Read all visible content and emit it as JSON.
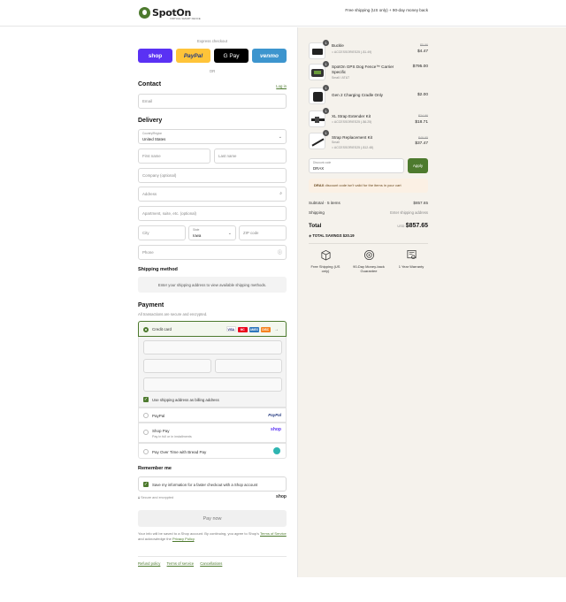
{
  "header": {
    "logo_text": "SpotOn",
    "logo_sub": "VIRTUAL SMART FENCE",
    "promo": "Free shipping (US only) + 90-day money back"
  },
  "express": {
    "label": "Express checkout",
    "buttons": [
      "shop",
      "PayPal",
      "G Pay",
      "venmo"
    ],
    "or": "OR"
  },
  "contact": {
    "title": "Contact",
    "login": "Log in",
    "email_placeholder": "Email"
  },
  "delivery": {
    "title": "Delivery",
    "country_label": "Country/Region",
    "country_value": "United States",
    "first_name": "First name",
    "last_name": "Last name",
    "company": "Company (optional)",
    "address": "Address",
    "apartment": "Apartment, suite, etc. (optional)",
    "city": "City",
    "state_label": "State",
    "state_value": "Iowa",
    "zip": "ZIP code",
    "phone": "Phone"
  },
  "shipping_method": {
    "title": "Shipping method",
    "info": "Enter your shipping address to view available shipping methods."
  },
  "payment": {
    "title": "Payment",
    "subtitle": "All transactions are secure and encrypted.",
    "credit_card": "Credit card",
    "brands": [
      "VISA",
      "MC",
      "AMEX",
      "DISC"
    ],
    "billing_same": "Use shipping address as billing address",
    "paypal": "PayPal",
    "paypal_logo": "PayPal",
    "shop_pay": "Shop Pay",
    "shop_pay_sub": "Pay in full or in installments",
    "shop_pay_logo": "shop",
    "bread": "Pay Over Time with Bread Pay"
  },
  "remember": {
    "title": "Remember me",
    "save_label": "Save my information for a faster checkout with a Shop account",
    "secure": "Secure and encrypted",
    "shop_logo": "shop"
  },
  "pay_now": "Pay now",
  "legal": {
    "text1": "Your info will be saved to a Shop account. By continuing, you agree to Shop's",
    "terms": "Terms of Service",
    "text2": "and acknowledge the",
    "privacy": "Privacy Policy",
    "end": "."
  },
  "footer_links": [
    "Refund policy",
    "Terms of service",
    "Cancellations"
  ],
  "cart": {
    "items": [
      {
        "qty": "1",
        "name": "Buckle",
        "sub": "ACCESSORIES25 (-$1.49)",
        "old_price": "$5.96",
        "price": "$4.47"
      },
      {
        "qty": "1",
        "name": "SpotOn GPS Dog Fence™ Carrier Specific",
        "sub": "Small / AT&T",
        "old_price": "",
        "price": "$795.00"
      },
      {
        "qty": "1",
        "name": "Gen 2 Charging Cradle Only",
        "sub": "",
        "old_price": "",
        "price": "$2.00"
      },
      {
        "qty": "1",
        "name": "XL Strap Extender Kit",
        "sub": "ACCESSORIES25 (-$6.25)",
        "old_price": "$24.96",
        "price": "$18.71"
      },
      {
        "qty": "1",
        "name": "Strap Replacement Kit",
        "sub2": "Small",
        "sub": "ACCESSORIES25 (-$12.48)",
        "old_price": "$49.95",
        "price": "$37.47"
      }
    ],
    "discount_label": "Discount code",
    "discount_value": "DRAX",
    "apply": "Apply",
    "warning_code": "DRAX",
    "warning_text": "discount code isn't valid for the items in your cart",
    "subtotal_label": "Subtotal · 5 items",
    "subtotal": "$857.65",
    "shipping_label": "Shipping",
    "shipping_value": "Enter shipping address",
    "total_label": "Total",
    "currency": "USD",
    "total": "$857.65",
    "savings_label": "TOTAL SAVINGS",
    "savings": "$20.19",
    "features": [
      "Free Shipping (US only)",
      "90-Day Money-back Guarantee",
      "1 Year Warranty"
    ]
  },
  "colors": {
    "brand_green": "#4d7a2e",
    "shop_purple": "#5a31f4",
    "paypal_yellow": "#ffc439",
    "venmo_blue": "#3d95ce"
  }
}
